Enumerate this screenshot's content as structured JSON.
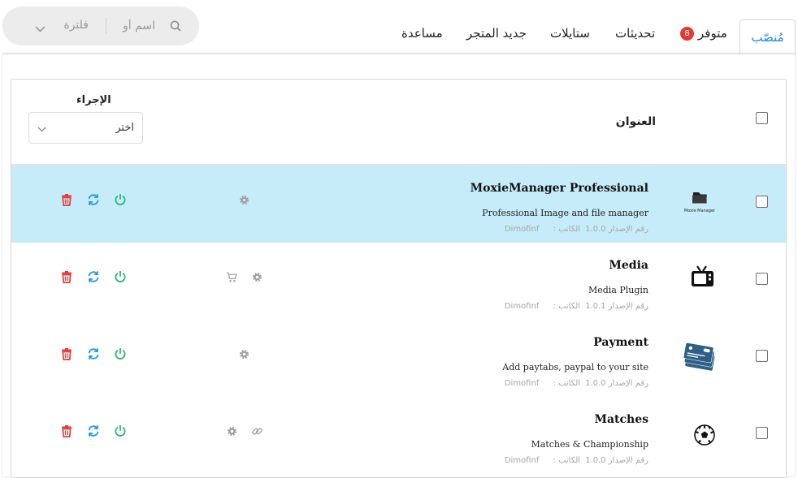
{
  "search": {
    "placeholder": "اسم أو",
    "filter_label": "فلترة"
  },
  "tabs": [
    {
      "label": "مُنصّب",
      "active": true
    },
    {
      "label": "متوفر",
      "badge": "8"
    },
    {
      "label": "تحديثات"
    },
    {
      "label": "ستايلات"
    },
    {
      "label": "جديد المتجر"
    },
    {
      "label": "مساعدة"
    }
  ],
  "table": {
    "title_header": "العنوان",
    "action_header": "الإجراء",
    "action_select": "اختر"
  },
  "rows": [
    {
      "name": "MoxieManager Professional",
      "description": "Professional Image and file manager",
      "version_label": "رقم الإصدار",
      "version": "1.0.0",
      "author_label": "الكاتب :",
      "author": "Dimofinf",
      "thumb_caption": "Moxie Manager",
      "icon": "folder-icon",
      "highlighted": true
    },
    {
      "name": "Media",
      "description": "Media Plugin",
      "version_label": "رقم الإصدار",
      "version": "1.0.1",
      "author_label": "الكاتب :",
      "author": "Dimofinf",
      "icon": "tv-icon"
    },
    {
      "name": "Payment",
      "description": "Add paytabs, paypal to your site",
      "version_label": "رقم الإصدار",
      "version": "1.0.0",
      "author_label": "الكاتب :",
      "author": "Dimofinf",
      "icon": "credit-cards-icon"
    },
    {
      "name": "Matches",
      "description": "Matches & Championship",
      "version_label": "رقم الإصدار",
      "version": "1.0.0",
      "author_label": "الكاتب :",
      "author": "Dimofinf",
      "icon": "soccer-ball-icon"
    }
  ],
  "colors": {
    "accent": "#1e88e5",
    "highlight_row": "#c6ecfa",
    "delete": "#e53935",
    "refresh": "#1e9be6",
    "power": "#2bb673",
    "badge": "#e53935",
    "muted_icon": "#9e9e9e"
  }
}
